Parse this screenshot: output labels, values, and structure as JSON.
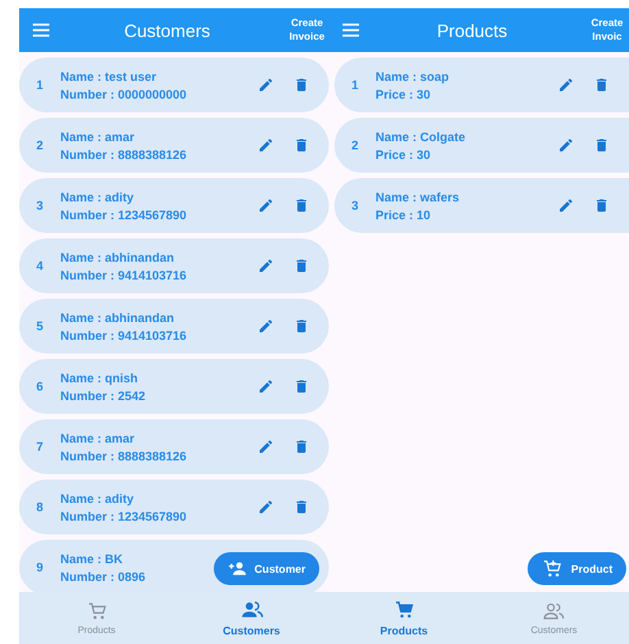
{
  "screens": [
    {
      "app_bar": {
        "title": "Customers",
        "action": "Create Invoice"
      },
      "items": [
        {
          "index": "1",
          "lines": [
            "Name : test user",
            "Number : 0000000000"
          ]
        },
        {
          "index": "2",
          "lines": [
            "Name : amar",
            "Number : 8888388126"
          ]
        },
        {
          "index": "3",
          "lines": [
            "Name : adity",
            "Number : 1234567890"
          ]
        },
        {
          "index": "4",
          "lines": [
            "Name : abhinandan",
            "Number : 9414103716"
          ]
        },
        {
          "index": "5",
          "lines": [
            "Name : abhinandan",
            "Number : 9414103716"
          ]
        },
        {
          "index": "6",
          "lines": [
            "Name : qnish",
            "Number : 2542"
          ]
        },
        {
          "index": "7",
          "lines": [
            "Name : amar",
            "Number : 8888388126"
          ]
        },
        {
          "index": "8",
          "lines": [
            "Name : adity",
            "Number : 1234567890"
          ]
        },
        {
          "index": "9",
          "lines": [
            "Name : BK",
            "Number : 0896"
          ]
        }
      ],
      "fab": {
        "label": "Customer",
        "kind": "person-add"
      },
      "nav": [
        {
          "label": "Products",
          "kind": "cart",
          "selected": false
        },
        {
          "label": "Customers",
          "kind": "people",
          "selected": true
        }
      ]
    },
    {
      "app_bar": {
        "title": "Products",
        "action": "Create Invoic"
      },
      "items": [
        {
          "index": "1",
          "lines": [
            "Name : soap",
            "Price : 30"
          ]
        },
        {
          "index": "2",
          "lines": [
            "Name : Colgate",
            "Price : 30"
          ]
        },
        {
          "index": "3",
          "lines": [
            "Name : wafers",
            "Price : 10"
          ]
        }
      ],
      "fab": {
        "label": "Product",
        "kind": "cart-add"
      },
      "nav": [
        {
          "label": "Products",
          "kind": "cart",
          "selected": true
        },
        {
          "label": "Customers",
          "kind": "people",
          "selected": false
        }
      ]
    }
  ]
}
